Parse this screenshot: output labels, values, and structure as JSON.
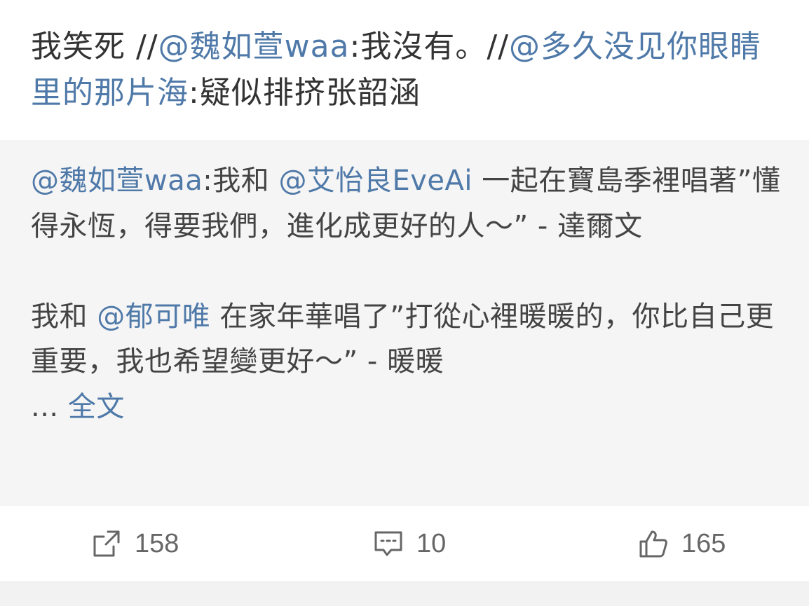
{
  "post": {
    "segments": [
      {
        "text": "我笑死 //",
        "type": "plain"
      },
      {
        "text": "@魏如萱waa",
        "type": "mention"
      },
      {
        "text": ":我沒有。//",
        "type": "plain"
      },
      {
        "text": "@多久没见你眼睛里的那片海",
        "type": "mention"
      },
      {
        "text": ":疑似排挤张韶涵",
        "type": "plain"
      }
    ]
  },
  "quote": {
    "paragraph1": [
      {
        "text": "@魏如萱waa",
        "type": "mention"
      },
      {
        "text": ":我和 ",
        "type": "plain"
      },
      {
        "text": "@艾怡良EveAi",
        "type": "mention"
      },
      {
        "text": " 一起在寶島季裡唱著”懂得永恆，得要我們，進化成更好的人～” - 達爾文",
        "type": "plain"
      }
    ],
    "paragraph2": [
      {
        "text": "我和 ",
        "type": "plain"
      },
      {
        "text": "@郁可唯",
        "type": "mention"
      },
      {
        "text": " 在家年華唱了”打從心裡暖暖的，你比自己更重要，我也希望變更好～” - 暖暖",
        "type": "plain"
      }
    ],
    "ellipsis": "...",
    "full_text_link": "全文"
  },
  "actions": {
    "repost": {
      "icon": "repost-icon",
      "count": "158"
    },
    "comment": {
      "icon": "comment-icon",
      "count": "10"
    },
    "like": {
      "icon": "thumbs-up-icon",
      "count": "165"
    }
  },
  "colors": {
    "mention": "#4f79a8",
    "text": "#333333",
    "quote_bg": "#f5f5f5",
    "icon": "#666666"
  }
}
